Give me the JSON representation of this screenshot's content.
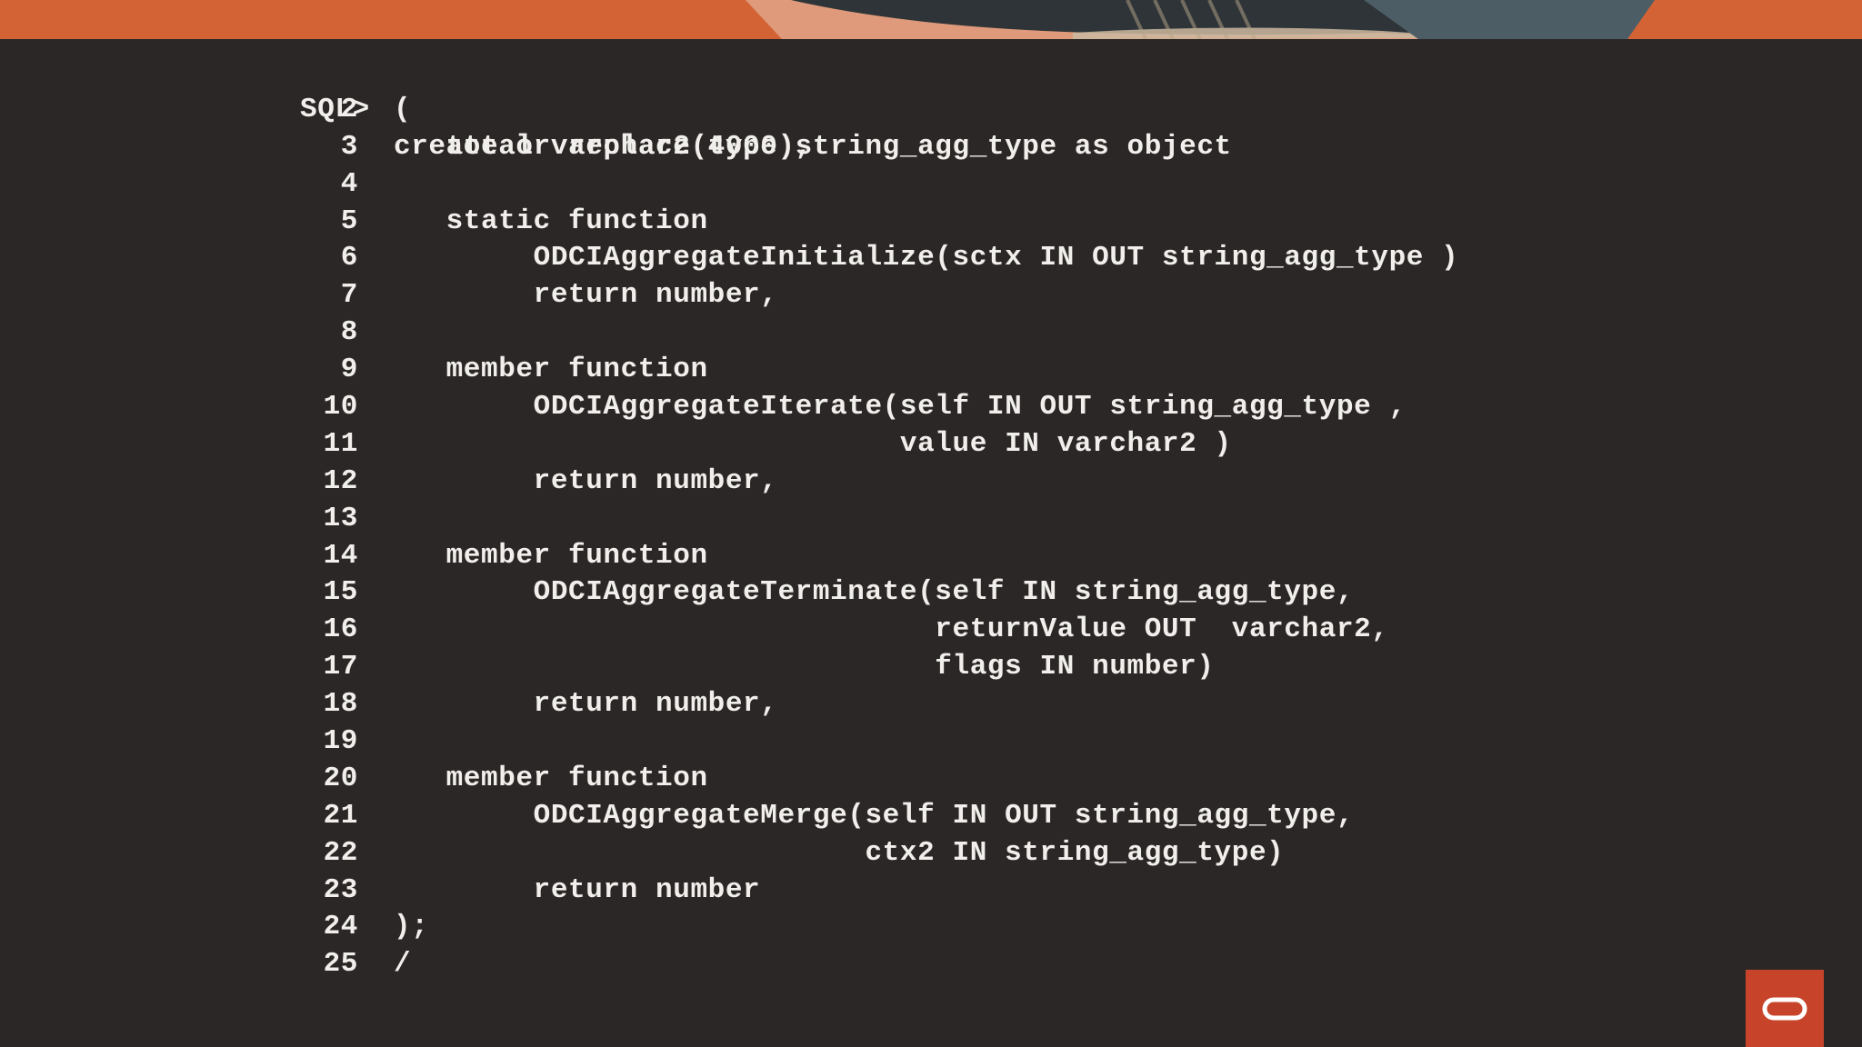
{
  "banner": {
    "colors": {
      "orange": "#d9683a",
      "dark": "#2e3438",
      "slate": "#4d5d66"
    }
  },
  "terminal": {
    "prompt": "SQL>",
    "first_line": "create or replace type string_agg_type as object",
    "lines": [
      {
        "num": "2",
        "text": "("
      },
      {
        "num": "3",
        "text": "   total varchar2(4000),"
      },
      {
        "num": "4",
        "text": ""
      },
      {
        "num": "5",
        "text": "   static function"
      },
      {
        "num": "6",
        "text": "        ODCIAggregateInitialize(sctx IN OUT string_agg_type )"
      },
      {
        "num": "7",
        "text": "        return number,"
      },
      {
        "num": "8",
        "text": ""
      },
      {
        "num": "9",
        "text": "   member function"
      },
      {
        "num": "10",
        "text": "        ODCIAggregateIterate(self IN OUT string_agg_type ,"
      },
      {
        "num": "11",
        "text": "                             value IN varchar2 )"
      },
      {
        "num": "12",
        "text": "        return number,"
      },
      {
        "num": "13",
        "text": ""
      },
      {
        "num": "14",
        "text": "   member function"
      },
      {
        "num": "15",
        "text": "        ODCIAggregateTerminate(self IN string_agg_type,"
      },
      {
        "num": "16",
        "text": "                               returnValue OUT  varchar2,"
      },
      {
        "num": "17",
        "text": "                               flags IN number)"
      },
      {
        "num": "18",
        "text": "        return number,"
      },
      {
        "num": "19",
        "text": ""
      },
      {
        "num": "20",
        "text": "   member function"
      },
      {
        "num": "21",
        "text": "        ODCIAggregateMerge(self IN OUT string_agg_type,"
      },
      {
        "num": "22",
        "text": "                           ctx2 IN string_agg_type)"
      },
      {
        "num": "23",
        "text": "        return number"
      },
      {
        "num": "24",
        "text": ");"
      },
      {
        "num": "25",
        "text": "/"
      }
    ],
    "colors": {
      "background": "#2b2726",
      "text": "#f1efec"
    }
  },
  "logo": {
    "icon": "oracle-logo-icon",
    "color": "#c7442a"
  }
}
